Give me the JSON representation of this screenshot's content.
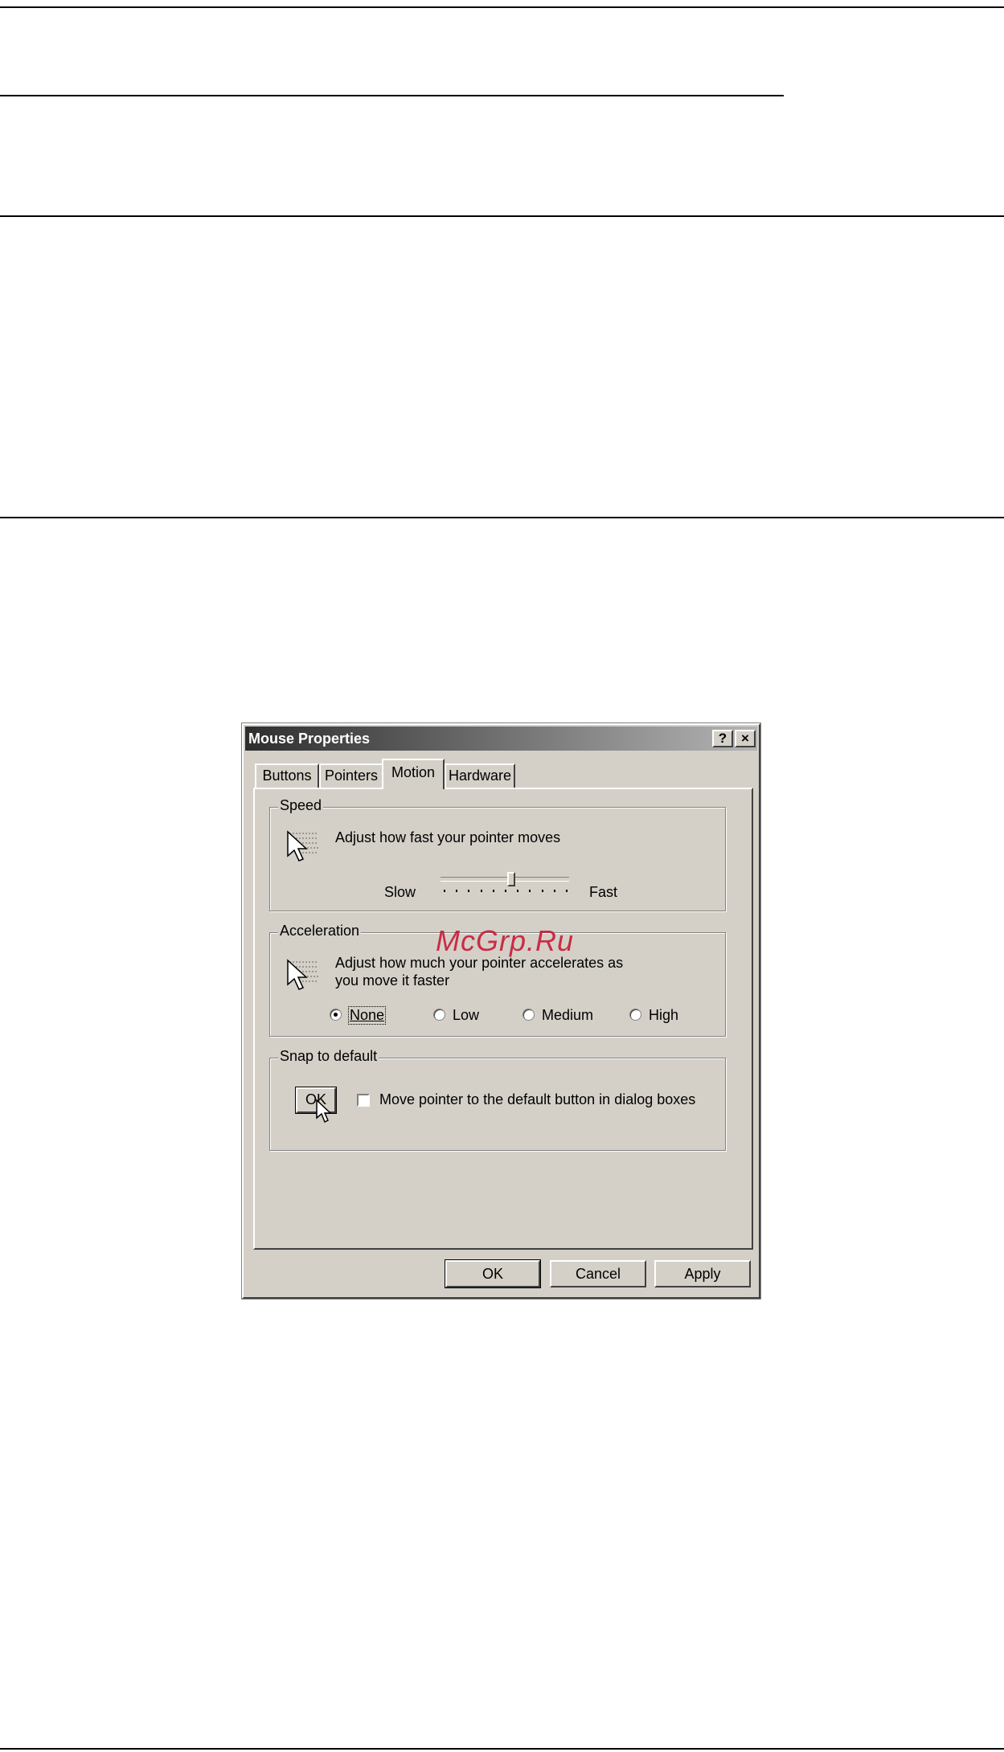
{
  "dialog": {
    "title": "Mouse Properties",
    "help_label": "?",
    "close_label": "×",
    "tabs": [
      {
        "label": "Buttons"
      },
      {
        "label": "Pointers"
      },
      {
        "label": "Motion"
      },
      {
        "label": "Hardware"
      }
    ],
    "active_tab": "Motion",
    "speed": {
      "legend": "Speed",
      "description": "Adjust how fast your pointer moves",
      "slow_label": "Slow",
      "fast_label": "Fast",
      "slider_value_fraction": 0.55
    },
    "acceleration": {
      "legend": "Acceleration",
      "description_line1": "Adjust how much your pointer accelerates as",
      "description_line2": "you move it faster",
      "options": [
        {
          "label": "None",
          "checked": true
        },
        {
          "label": "Low",
          "checked": false
        },
        {
          "label": "Medium",
          "checked": false
        },
        {
          "label": "High",
          "checked": false
        }
      ]
    },
    "snap": {
      "legend": "Snap to default",
      "demo_button_label": "OK",
      "checkbox_label": "Move pointer to the default button in dialog boxes",
      "checkbox_checked": false
    },
    "buttons": {
      "ok": "OK",
      "cancel": "Cancel",
      "apply": "Apply"
    }
  },
  "watermark": "McGrp.Ru",
  "icons": [
    "pointer-speed-icon",
    "pointer-acceleration-icon",
    "help-icon",
    "close-icon",
    "cursor-arrow-icon"
  ]
}
